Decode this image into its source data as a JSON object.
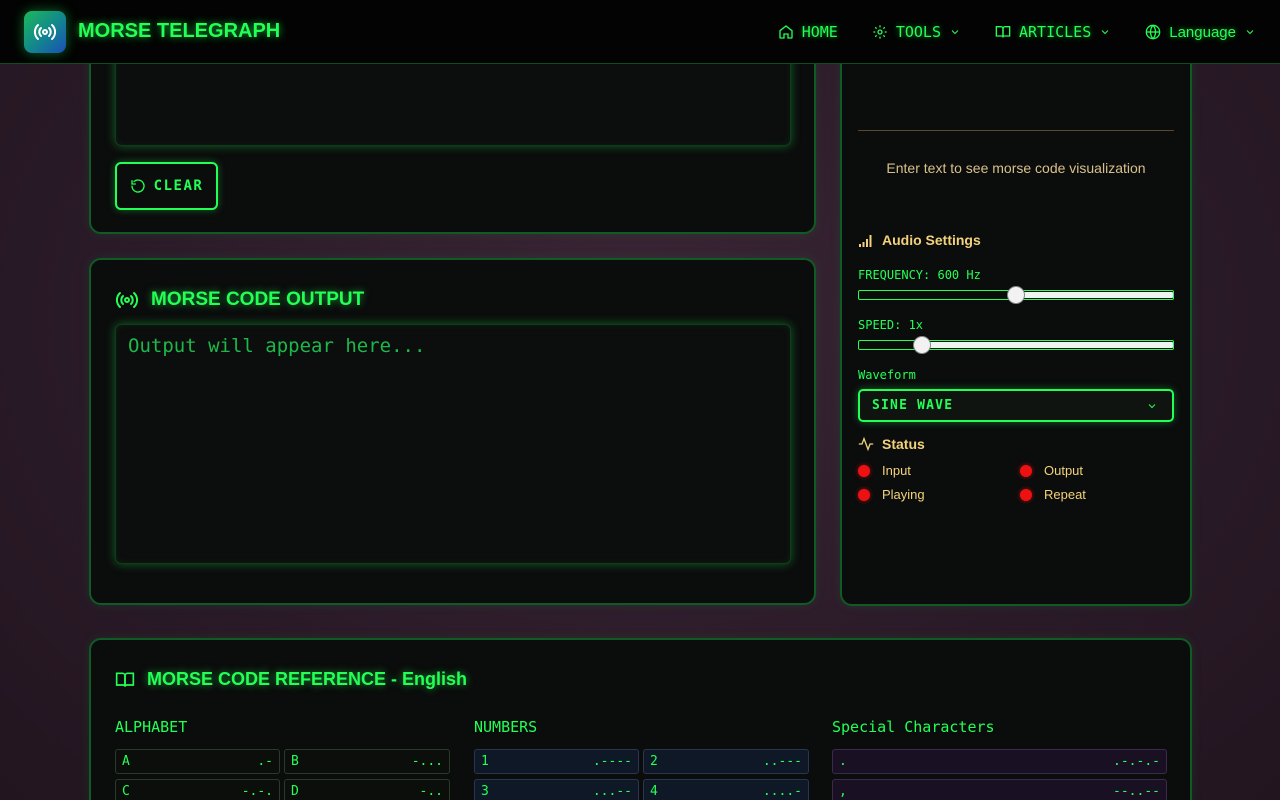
{
  "nav": {
    "brand": "MORSE TELEGRAPH",
    "items": [
      {
        "label": "HOME",
        "icon": "home-icon"
      },
      {
        "label": "TOOLS",
        "icon": "gear-icon"
      },
      {
        "label": "ARTICLES",
        "icon": "book-icon"
      },
      {
        "label": "Language",
        "icon": "globe-icon"
      }
    ]
  },
  "input_panel": {
    "clear_label": "CLEAR"
  },
  "output_panel": {
    "title": "MORSE CODE OUTPUT",
    "placeholder": "Output will appear here..."
  },
  "side_panel": {
    "visualization_text": "Enter text to see morse code visualization",
    "audio_title": "Audio Settings",
    "frequency_label": "FREQUENCY: 600 Hz",
    "frequency_fraction": 0.5,
    "speed_label": "SPEED: 1x",
    "speed_fraction": 0.2,
    "waveform_label": "Waveform",
    "waveform_value": "SINE WAVE",
    "status_title": "Status",
    "status": [
      {
        "label": "Input",
        "color": "#ee1111"
      },
      {
        "label": "Output",
        "color": "#ee1111"
      },
      {
        "label": "Playing",
        "color": "#ee1111"
      },
      {
        "label": "Repeat",
        "color": "#ee1111"
      }
    ]
  },
  "reference": {
    "title": "MORSE CODE REFERENCE - English",
    "alphabet_title": "ALPHABET",
    "numbers_title": "NUMBERS",
    "special_title": "Special Characters",
    "alphabet": [
      {
        "char": "A",
        "code": ".-"
      },
      {
        "char": "B",
        "code": "-..."
      },
      {
        "char": "C",
        "code": "-.-."
      },
      {
        "char": "D",
        "code": "-.."
      }
    ],
    "numbers": [
      {
        "char": "1",
        "code": ".----"
      },
      {
        "char": "2",
        "code": "..---"
      },
      {
        "char": "3",
        "code": "...--"
      },
      {
        "char": "4",
        "code": "....-"
      }
    ],
    "special": [
      {
        "char": ".",
        "code": ".-.-.-"
      },
      {
        "char": ",",
        "code": "--..--"
      }
    ]
  },
  "colors": {
    "accent": "#22ff55",
    "status_off": "#ee1111",
    "gold": "#f2d27a"
  }
}
